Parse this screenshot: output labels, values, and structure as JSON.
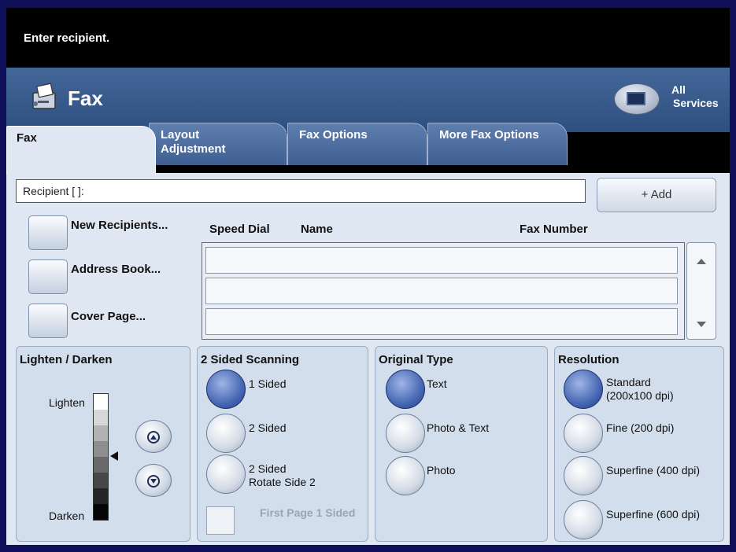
{
  "message": "Enter recipient.",
  "header": {
    "title": "Fax",
    "all_services": [
      "All",
      "Services"
    ]
  },
  "tabs": [
    "Fax",
    "Layout Adjustment",
    "Fax Options",
    "More Fax Options"
  ],
  "tabs_lines": {
    "layout_1": "Layout",
    "layout_2": "Adjustment"
  },
  "recipient": {
    "field_value": "Recipient [   ]:",
    "add_label": "+ Add"
  },
  "left_buttons": [
    "New Recipients...",
    "Address Book...",
    "Cover Page..."
  ],
  "list_headers": {
    "speed_dial": "Speed Dial",
    "name": "Name",
    "fax_number": "Fax Number"
  },
  "lighten_darken": {
    "title": "Lighten / Darken",
    "lighten": "Lighten",
    "darken": "Darken",
    "level": "4 of 8"
  },
  "two_sided": {
    "title": "2 Sided Scanning",
    "options": [
      "1 Sided",
      "2 Sided",
      "2 Sided"
    ],
    "option3_line2": "Rotate Side 2",
    "first_page": "First Page 1 Sided",
    "selected": "1 Sided"
  },
  "original_type": {
    "title": "Original Type",
    "options": [
      "Text",
      "Photo & Text",
      "Photo"
    ],
    "selected": "Text"
  },
  "resolution": {
    "title": "Resolution",
    "options": [
      "Standard",
      "Fine (200 dpi)",
      "Superfine (400 dpi)",
      "Superfine (600 dpi)"
    ],
    "standard_line2": "(200x100 dpi)",
    "selected": "Standard"
  }
}
